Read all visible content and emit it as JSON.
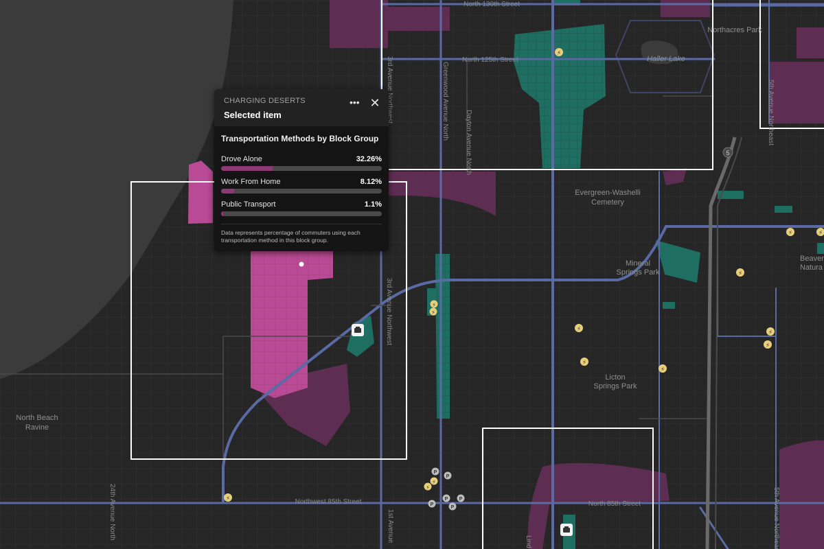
{
  "popup": {
    "kicker": "CHARGING DESERTS",
    "title": "Selected item",
    "more_icon": "ellipsis-icon",
    "close_icon": "close-icon",
    "section_title": "Transportation Methods by Block Group",
    "rows": [
      {
        "label": "Drove Alone",
        "value": "32.26%",
        "fraction": 0.3226
      },
      {
        "label": "Work From Home",
        "value": "8.12%",
        "fraction": 0.0812
      },
      {
        "label": "Public Transport",
        "value": "1.1%",
        "fraction": 0.011
      }
    ],
    "note": "Data represents percentage of commuters using each transportation method in this block group."
  },
  "map": {
    "colors": {
      "water": "#3b3b3b",
      "land": "#262626",
      "major_road": "#5a6aa5",
      "desert_fill": "#b94a95",
      "desert_dim": "#5e2e52",
      "charger_area": "#1f6e62",
      "selection_box": "#ffffff"
    },
    "places": {
      "haller_lake": "Haller Lake",
      "northacres_park": "Northacres Park",
      "evergreen_1": "Evergreen-Washelli",
      "evergreen_2": "Cemetery",
      "mineral_1": "Mineral",
      "mineral_2": "Springs Park",
      "licton_1": "Licton",
      "licton_2": "Springs Park",
      "north_beach_1": "North Beach",
      "north_beach_2": "Ravine",
      "beaver_1": "Beaver",
      "beaver_2": "Natura"
    },
    "streets": {
      "n130": "North 130th Street",
      "n125": "North 125th Street",
      "nw85": "Northwest 85th Street",
      "n85": "North 85th Street",
      "greenwood": "Greenwood Avenue North",
      "dayton": "Dayton Avenue North",
      "third_ave_nw_upper": "3rd Avenue Northwest",
      "third_ave_nw": "3rd Avenue Northwest",
      "ave24": "24th Avenue North",
      "first_ave": "1st Avenue",
      "fifth_ave_ne": "5th Avenue Northeast",
      "fifth_ave_ne_lower": "5th Avenue Northeast",
      "linden": "Lind"
    },
    "highway_shield": "5",
    "icons": {
      "charging": "ev-charging-icon",
      "parking": "parking-icon",
      "garage": "parking-garage-icon",
      "parking_letter": "P"
    }
  }
}
